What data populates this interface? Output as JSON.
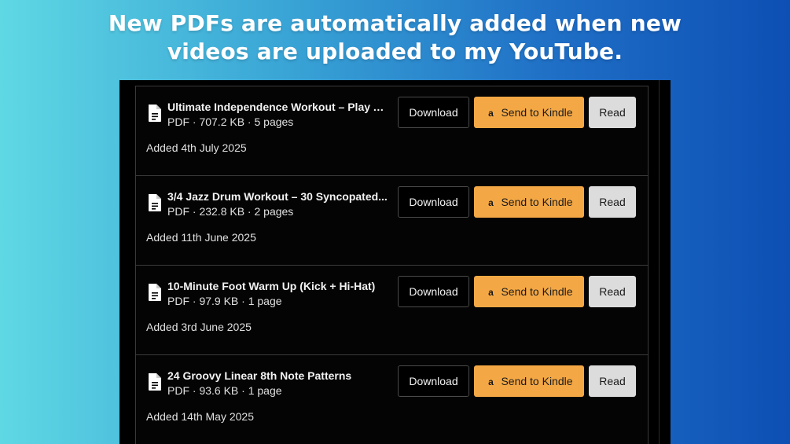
{
  "headline": {
    "line1": "New PDFs are automatically added when new",
    "line2": "videos are uploaded to my YouTube."
  },
  "buttons": {
    "download": "Download",
    "kindle": "Send to Kindle",
    "read": "Read"
  },
  "icons": {
    "file": "document-icon",
    "kindle": "amazon-icon"
  },
  "colors": {
    "kindle_button": "#f4a845",
    "read_button": "#dcdcdc",
    "panel_bg": "#000000"
  },
  "files": [
    {
      "title": "Ultimate Independence Workout – Play An...",
      "meta": "PDF · 707.2 KB · 5 pages",
      "added": "Added 4th July 2025"
    },
    {
      "title": "3/4 Jazz Drum Workout – 30 Syncopated...",
      "meta": "PDF · 232.8 KB · 2 pages",
      "added": "Added 11th June 2025"
    },
    {
      "title": "10-Minute Foot Warm Up (Kick + Hi-Hat)",
      "meta": "PDF · 97.9 KB · 1 page",
      "added": "Added 3rd June 2025"
    },
    {
      "title": "24 Groovy Linear 8th Note Patterns",
      "meta": "PDF · 93.6 KB · 1 page",
      "added": "Added 14th May 2025"
    }
  ]
}
